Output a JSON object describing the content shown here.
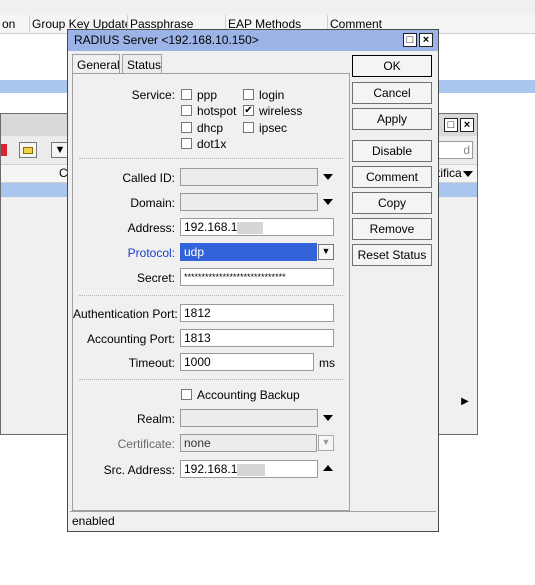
{
  "background": {
    "columns": [
      "on",
      "Group Key Update",
      "Passphrase",
      "EAP Methods",
      "Comment"
    ],
    "win2_col_left": "C",
    "win2_col_right": "tifica",
    "win2_filter_text": "d"
  },
  "dialog": {
    "title": "RADIUS Server <192.168.10.150>",
    "tabs": [
      "General",
      "Status"
    ],
    "service_label": "Service:",
    "services": [
      {
        "label": "ppp",
        "checked": false
      },
      {
        "label": "login",
        "checked": false
      },
      {
        "label": "hotspot",
        "checked": false
      },
      {
        "label": "wireless",
        "checked": true
      },
      {
        "label": "dhcp",
        "checked": false
      },
      {
        "label": "ipsec",
        "checked": false
      },
      {
        "label": "dot1x",
        "checked": false
      }
    ],
    "called_id_label": "Called ID:",
    "called_id": "",
    "domain_label": "Domain:",
    "domain": "",
    "address_label": "Address:",
    "address": "192.168.1",
    "protocol_label": "Protocol:",
    "protocol": "udp",
    "secret_label": "Secret:",
    "secret": "*****************************",
    "auth_port_label": "Authentication Port:",
    "auth_port": "1812",
    "acct_port_label": "Accounting Port:",
    "acct_port": "1813",
    "timeout_label": "Timeout:",
    "timeout": "1000",
    "timeout_unit": "ms",
    "accounting_backup_label": "Accounting Backup",
    "realm_label": "Realm:",
    "realm": "",
    "certificate_label": "Certificate:",
    "certificate": "none",
    "src_address_label": "Src. Address:",
    "src_address": "192.168.1",
    "status_text": "enabled",
    "buttons": {
      "ok": "OK",
      "cancel": "Cancel",
      "apply": "Apply",
      "disable": "Disable",
      "comment": "Comment",
      "copy": "Copy",
      "remove": "Remove",
      "reset_status": "Reset Status"
    },
    "title_buttons": {
      "restore": "□",
      "close": "×"
    },
    "colors": {
      "title_bar": "#9bb3e6",
      "protocol_label": "#1a3ec8",
      "selection": "#3363d8"
    }
  }
}
